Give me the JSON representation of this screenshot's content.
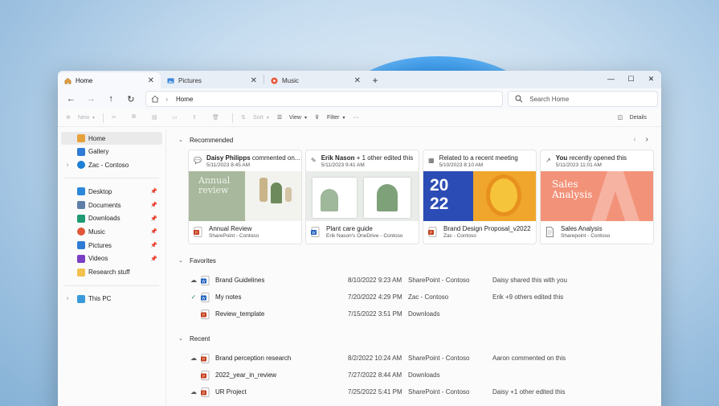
{
  "tabs": [
    {
      "label": "Home",
      "active": true,
      "icon": "home-icon"
    },
    {
      "label": "Pictures",
      "active": false,
      "icon": "pictures-folder-icon"
    },
    {
      "label": "Music",
      "active": false,
      "icon": "music-icon"
    }
  ],
  "address": {
    "crumb": "Home"
  },
  "search": {
    "placeholder": "Search Home"
  },
  "toolbar": {
    "new_label": "New",
    "sort_label": "Sort",
    "view_label": "View",
    "filter_label": "Filter",
    "more_label": "···",
    "details_label": "Details"
  },
  "sidebar": {
    "top": [
      {
        "label": "Home",
        "icon": "home-icon",
        "active": true
      },
      {
        "label": "Gallery",
        "icon": "gallery-icon"
      },
      {
        "label": "Zac - Contoso",
        "icon": "cloud-icon",
        "expandable": true
      }
    ],
    "quick": [
      {
        "label": "Desktop",
        "icon": "desktop-icon",
        "color": "#2b88d8"
      },
      {
        "label": "Documents",
        "icon": "documents-icon",
        "color": "#5f7ea8"
      },
      {
        "label": "Downloads",
        "icon": "downloads-icon",
        "color": "#1f9a73"
      },
      {
        "label": "Music",
        "icon": "music-icon",
        "color": "#e0573a"
      },
      {
        "label": "Pictures",
        "icon": "pictures-icon",
        "color": "#2f7bd6"
      },
      {
        "label": "Videos",
        "icon": "videos-icon",
        "color": "#7b3fc4"
      },
      {
        "label": "Research stuff",
        "icon": "folder-icon",
        "color": "#f2c14e"
      }
    ],
    "thispc": {
      "label": "This PC",
      "icon": "this-pc-icon"
    }
  },
  "recommended": {
    "heading": "Recommended",
    "cards": [
      {
        "who_bold": "Daisy Philipps",
        "who_rest": " commented on...",
        "when": "5/11/2023 8:45 AM",
        "icon": "comment-icon",
        "thumb_text": "Annual review",
        "file": "Annual Review",
        "loc": "SharePoint - Contoso",
        "type": "ppt"
      },
      {
        "who_bold": "Erik Nason",
        "who_rest": " + 1 other edited this",
        "when": "5/11/2023 9:41 AM",
        "icon": "edit-icon",
        "thumb_text": "",
        "file": "Plant care guide",
        "loc": "Erik Nason's OneDrive - Contoso",
        "type": "word"
      },
      {
        "who_bold": "",
        "who_rest": "Related to a recent meeting",
        "when": "5/10/2023 8:10 AM",
        "icon": "calendar-icon",
        "thumb_text": "20 22",
        "file": "Brand Design Proposal_v2022",
        "loc": "Zac - Contoso",
        "type": "ppt"
      },
      {
        "who_bold": "You",
        "who_rest": " recently opened this",
        "when": "5/11/2023 11:01 AM",
        "icon": "open-icon",
        "thumb_text": "Sales Analysis",
        "file": "Sales Analysis",
        "loc": "Sharepoint - Contoso",
        "type": "doc"
      }
    ]
  },
  "favorites": {
    "heading": "Favorites",
    "rows": [
      {
        "status": "cloud",
        "type": "word",
        "name": "Brand Guidelines",
        "date": "8/10/2022 9:23 AM",
        "loc": "SharePoint - Contoso",
        "act": "Daisy shared this with you"
      },
      {
        "status": "check",
        "type": "word",
        "name": "My notes",
        "date": "7/20/2022 4:29 PM",
        "loc": "Zac - Contoso",
        "act": "Erik +9 others edited this"
      },
      {
        "status": "",
        "type": "ppt",
        "name": "Review_template",
        "date": "7/15/2022 3:51 PM",
        "loc": "Downloads",
        "act": ""
      }
    ]
  },
  "recent": {
    "heading": "Recent",
    "rows": [
      {
        "status": "cloud",
        "type": "ppt",
        "name": "Brand perception research",
        "date": "8/2/2022 10:24 AM",
        "loc": "SharePoint - Contoso",
        "act": "Aaron commented on this"
      },
      {
        "status": "",
        "type": "ppt",
        "name": "2022_year_in_review",
        "date": "7/27/2022 8:44 AM",
        "loc": "Downloads",
        "act": ""
      },
      {
        "status": "cloud",
        "type": "ppt",
        "name": "UR Project",
        "date": "7/25/2022 5:41 PM",
        "loc": "SharePoint - Contoso",
        "act": "Daisy +1 other edited this"
      }
    ]
  }
}
